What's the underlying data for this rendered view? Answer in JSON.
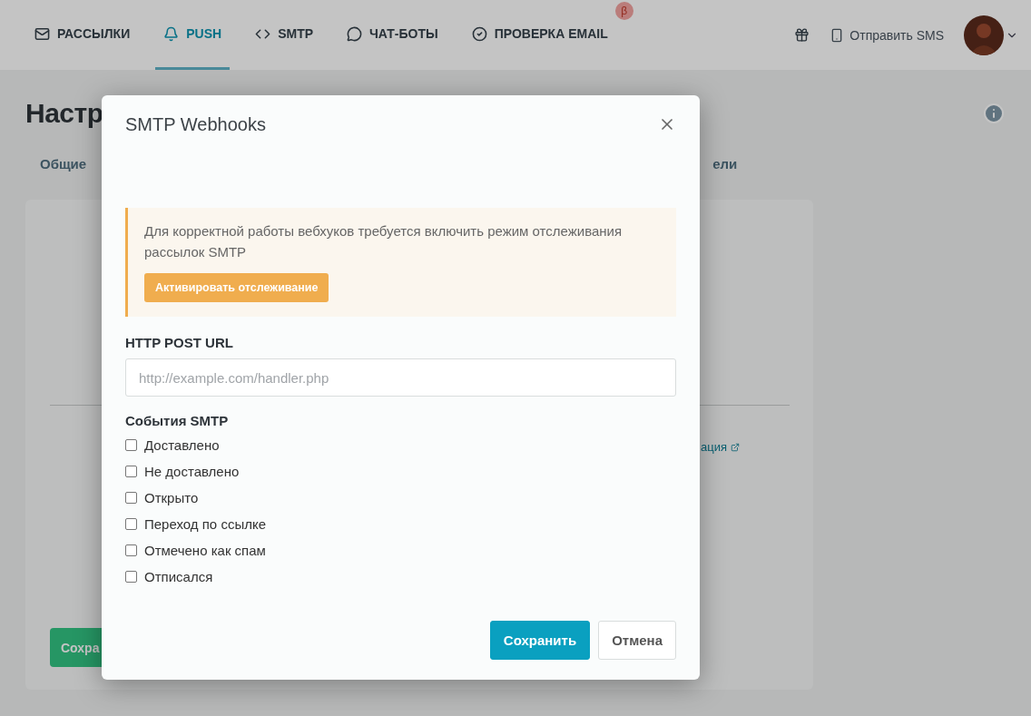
{
  "nav": {
    "items": [
      {
        "label": "РАССЫЛКИ",
        "selected": false
      },
      {
        "label": "PUSH",
        "selected": true
      },
      {
        "label": "SMTP",
        "selected": false
      },
      {
        "label": "ЧАТ-БОТЫ",
        "selected": false
      },
      {
        "label": "ПРОВЕРКА EMAIL",
        "selected": false,
        "badge": "β"
      }
    ],
    "sms_link": "Отправить SMS"
  },
  "page": {
    "title": "Настр",
    "tabs": [
      {
        "label": "Общие",
        "selected": false
      },
      {
        "label": "ели",
        "selected": false
      }
    ],
    "link": "ация",
    "save_button": "Сохра"
  },
  "dialog": {
    "title": "SMTP Webhooks",
    "alert": {
      "text": "Для корректной работы вебхуков требуется включить режим отслеживания рассылок SMTP",
      "button": "Активировать отслеживание"
    },
    "url_label": "HTTP POST URL",
    "url_placeholder": "http://example.com/handler.php",
    "events_label": "События SMTP",
    "events": [
      {
        "label": "Доставлено",
        "checked": false
      },
      {
        "label": "Не доставлено",
        "checked": false
      },
      {
        "label": "Открыто",
        "checked": false
      },
      {
        "label": "Переход по ссылке",
        "checked": false
      },
      {
        "label": "Отмечено как спам",
        "checked": false
      },
      {
        "label": "Отписался",
        "checked": false
      }
    ],
    "buttons": [
      {
        "label": "Сохранить",
        "kind": "primary"
      },
      {
        "label": "Отмена",
        "kind": "secondary"
      }
    ]
  }
}
